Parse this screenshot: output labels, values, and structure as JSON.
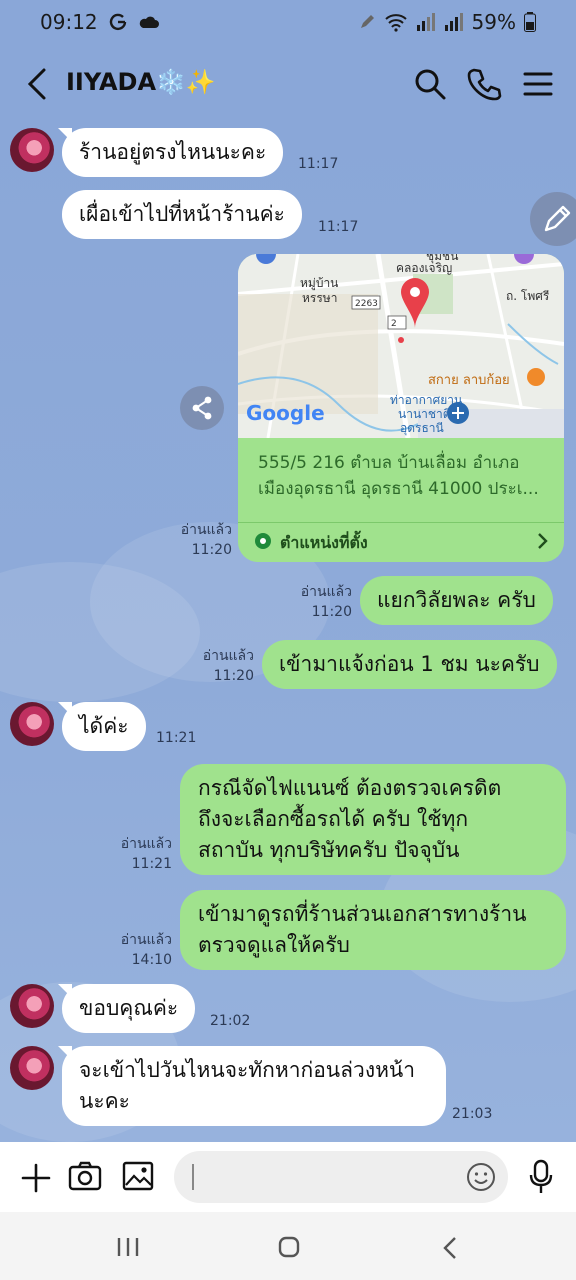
{
  "status": {
    "time": "09:12",
    "battery": "59%"
  },
  "header": {
    "title": "IIYADA❄️✨"
  },
  "messages": [
    {
      "id": "m1",
      "text": "ร้านอยู่ตรงไหนนะคะ",
      "time": "11:17"
    },
    {
      "id": "m2",
      "text": "เผื่อเข้าไปที่หน้าร้านค่ะ",
      "time": "11:17"
    },
    {
      "id": "m4",
      "text": "แยกวิลัยพละ ครับ",
      "read": "อ่านแล้ว",
      "time": "11:20"
    },
    {
      "id": "m5",
      "text": "เข้ามาแจ้งก่อน 1 ชม นะครับ",
      "read": "อ่านแล้ว",
      "time": "11:20"
    },
    {
      "id": "m6",
      "text": "ได้ค่ะ",
      "time": "11:21"
    },
    {
      "id": "m7",
      "lines": [
        "กรณีจัดไฟแนนซ์ ต้องตรวจเครดิต",
        "ถึงจะเลือกซื้อรถได้ ครับ ใช้ทุก",
        "สถาบัน ทุกบริษัทครับ ปัจจุบัน"
      ],
      "read": "อ่านแล้ว",
      "time": "11:21"
    },
    {
      "id": "m8",
      "lines": [
        "เข้ามาดูรถที่ร้านส่วนเอกสารทางร้าน",
        "ตรวจดูแลให้ครับ"
      ],
      "read": "อ่านแล้ว",
      "time": "14:10"
    },
    {
      "id": "m9",
      "text": "ขอบคุณค่ะ",
      "time": "21:02"
    },
    {
      "id": "m10",
      "lines": [
        "จะเข้าไปวันไหนจะทักหาก่อนล่วงหน้า",
        "นะคะ"
      ],
      "time": "21:03"
    }
  ],
  "location": {
    "address_line1": "555/5 216 ตำบล บ้านเลื่อม อำเภอ",
    "address_line2": "เมืองอุดรธานี อุดรธานี 41000 ประเ...",
    "link_label": "ตำแหน่งที่ตั้ง",
    "read": "อ่านแล้ว",
    "time": "11:20",
    "map_labels": {
      "village": "หมู่บ้าน",
      "village2": "หรรษา",
      "community": "ชุมชน",
      "community2": "คลองเจริญ",
      "road_num": "2263",
      "road_num2": "2",
      "road_name": "ถ. โพศรี",
      "shop": "สกาย ลาบก้อย",
      "airport": "ท่าอากาศยาน",
      "airport2": "นานาชาติ",
      "airport3": "อุดรธานี",
      "google": "Google"
    }
  },
  "colors": {
    "chat_bg": "#8aa7d8",
    "outgoing_bubble": "#a0e28d",
    "incoming_bubble": "#ffffff",
    "map_pin": "#e8404a"
  }
}
